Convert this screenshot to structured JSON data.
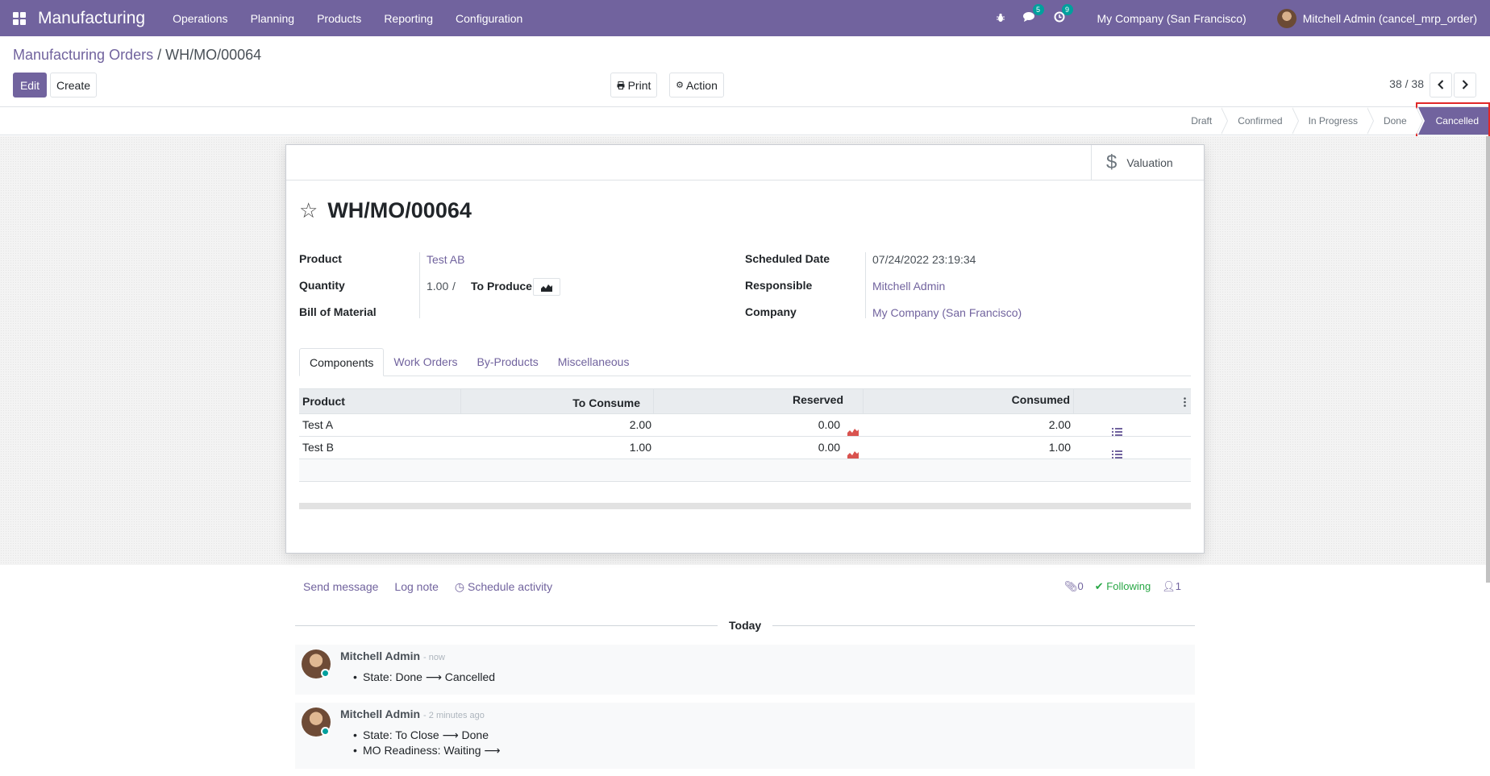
{
  "navbar": {
    "app_name": "Manufacturing",
    "menu": [
      "Operations",
      "Planning",
      "Products",
      "Reporting",
      "Configuration"
    ],
    "messages_badge": "5",
    "activities_badge": "9",
    "company": "My Company (San Francisco)",
    "user": "Mitchell Admin (cancel_mrp_order)"
  },
  "breadcrumb": {
    "parent": "Manufacturing Orders",
    "separator": "/",
    "current": "WH/MO/00064"
  },
  "toolbar": {
    "edit_label": "Edit",
    "create_label": "Create",
    "print_label": "Print",
    "action_label": "Action",
    "pager": "38 / 38"
  },
  "statusbar": {
    "stages": [
      "Draft",
      "Confirmed",
      "In Progress",
      "Done",
      "Cancelled"
    ],
    "active": "Cancelled"
  },
  "sheet": {
    "valuation_label": "Valuation",
    "title": "WH/MO/00064",
    "fields_left": {
      "product_label": "Product",
      "product_value": "Test AB",
      "quantity_label": "Quantity",
      "quantity_value": "1.00",
      "quantity_sep": "/",
      "to_produce_label": "To Produce",
      "bom_label": "Bill of Material"
    },
    "fields_right": {
      "scheduled_label": "Scheduled Date",
      "scheduled_value": "07/24/2022 23:19:34",
      "responsible_label": "Responsible",
      "responsible_value": "Mitchell Admin",
      "company_label": "Company",
      "company_value": "My Company (San Francisco)"
    },
    "tabs": [
      "Components",
      "Work Orders",
      "By-Products",
      "Miscellaneous"
    ],
    "table": {
      "headers": [
        "Product",
        "To Consume",
        "Reserved",
        "Consumed"
      ],
      "rows": [
        {
          "product": "Test A",
          "to_consume": "2.00",
          "reserved": "0.00",
          "consumed": "2.00"
        },
        {
          "product": "Test B",
          "to_consume": "1.00",
          "reserved": "0.00",
          "consumed": "1.00"
        }
      ]
    }
  },
  "chatter": {
    "send_message": "Send message",
    "log_note": "Log note",
    "schedule_activity": "Schedule activity",
    "attachments": "0",
    "following": "Following",
    "followers": "1",
    "today": "Today",
    "messages": [
      {
        "author": "Mitchell Admin",
        "date": "- now",
        "lines": [
          "State: Done ⟶ Cancelled"
        ]
      },
      {
        "author": "Mitchell Admin",
        "date": "- 2 minutes ago",
        "lines": [
          "State: To Close ⟶ Done",
          "MO Readiness: Waiting ⟶"
        ]
      }
    ]
  },
  "colors": {
    "brand": "#71639e",
    "highlight": "#e02828",
    "following": "#28a745",
    "chart_red": "#d9534f"
  }
}
